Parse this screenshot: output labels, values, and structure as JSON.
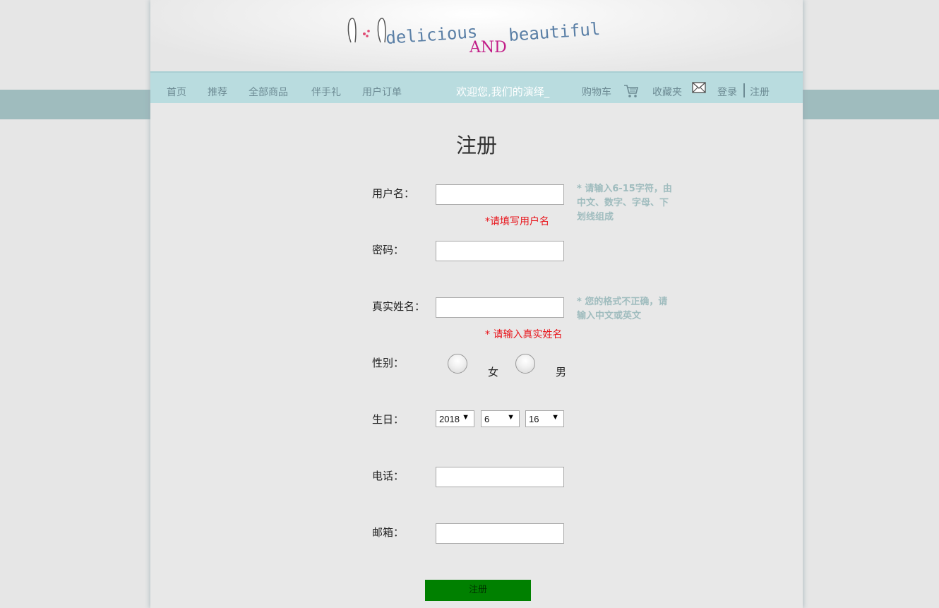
{
  "logo": {
    "word1": "delicious",
    "word2": "AND",
    "word3": "beautiful"
  },
  "nav": {
    "items": [
      "首页",
      "推荐",
      "全部商品",
      "伴手礼",
      "用户订单"
    ],
    "welcome": "欢迎您,我们的演绎_",
    "cart": "购物车",
    "favorites": "收藏夹",
    "login": "登录",
    "register": "注册"
  },
  "form": {
    "title": "注册",
    "username": {
      "label": "用户名：",
      "value": "",
      "error": "*请填写用户名",
      "hint": "* 请输入6-15字符，由中文、数字、字母、下划线组成"
    },
    "password": {
      "label": "密码：",
      "value": ""
    },
    "realname": {
      "label": "真实姓名：",
      "value": "",
      "error": "* 请输入真实姓名",
      "hint": "* 您的格式不正确，请输入中文或英文"
    },
    "gender": {
      "label": "性别：",
      "options": [
        "女",
        "男"
      ]
    },
    "birthday": {
      "label": "生日：",
      "year": "2018",
      "month": "6",
      "day": "16"
    },
    "phone": {
      "label": "电话：",
      "value": ""
    },
    "email": {
      "label": "邮箱：",
      "value": ""
    },
    "submit": "注册"
  },
  "colors": {
    "nav_bg": "#b9dcdf",
    "band": "#9fbcbe",
    "error": "#e8141b",
    "hint": "#9fbcbe",
    "submit_bg": "#008000"
  },
  "icons": {
    "cart": "cart-icon",
    "favorites": "envelope-icon",
    "select_arrow": "triangle-down-icon"
  }
}
